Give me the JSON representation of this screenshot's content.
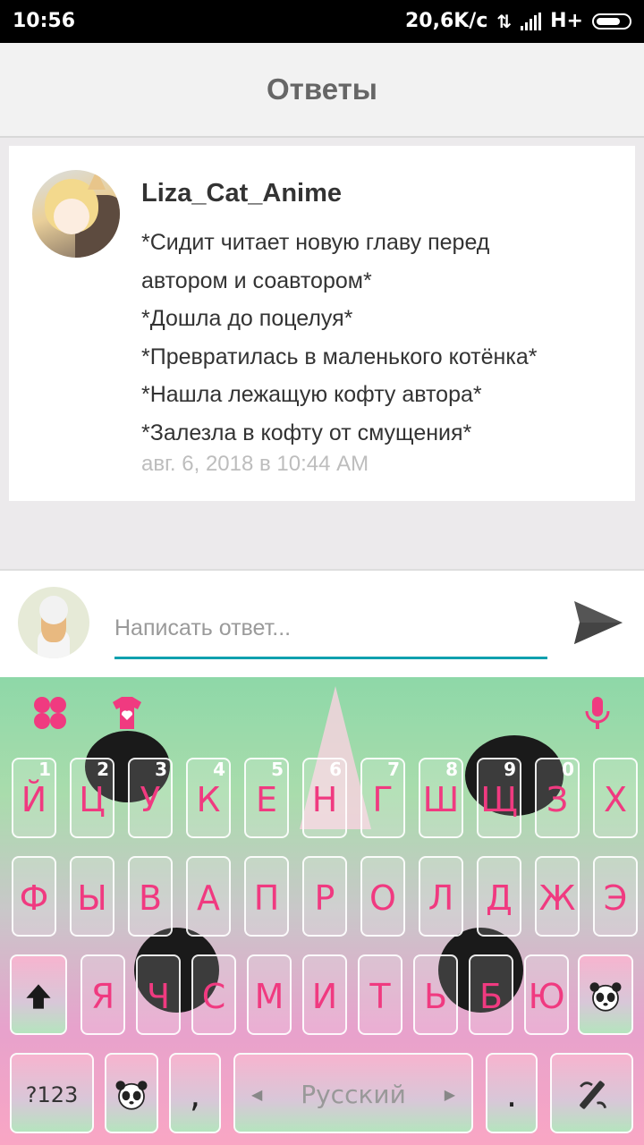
{
  "status": {
    "time": "10:56",
    "speed": "20,6K/c",
    "network": "H+"
  },
  "header": {
    "title": "Ответы"
  },
  "comment": {
    "username": "Liza_Cat_Anime",
    "lines": [
      "*Сидит читает новую главу перед",
      "автором и соавтором*",
      "*Дошла до поцелуя*",
      "*Превратилась в маленького котёнка*",
      "*Нашла лежащую кофту автора*",
      "*Залезла в кофту от смущения*"
    ],
    "timestamp": "авг. 6, 2018 в 10:44 AM"
  },
  "reply": {
    "placeholder": "Написать ответ...",
    "value": ""
  },
  "keyboard": {
    "row1": [
      "Й",
      "Ц",
      "У",
      "К",
      "Е",
      "Н",
      "Г",
      "Ш",
      "Щ",
      "З",
      "Х"
    ],
    "row1_hints": [
      "1",
      "2",
      "3",
      "4",
      "5",
      "6",
      "7",
      "8",
      "9",
      "0"
    ],
    "row2": [
      "Ф",
      "Ы",
      "В",
      "А",
      "П",
      "Р",
      "О",
      "Л",
      "Д",
      "Ж",
      "Э"
    ],
    "row3": [
      "Я",
      "Ч",
      "С",
      "М",
      "И",
      "Т",
      "Ь",
      "Б",
      "Ю"
    ],
    "mode_label": "?123",
    "space_label": "Русский",
    "comma": ",",
    "period": "."
  },
  "colors": {
    "accent": "#0FA0AE",
    "key_text": "#F03A80"
  }
}
